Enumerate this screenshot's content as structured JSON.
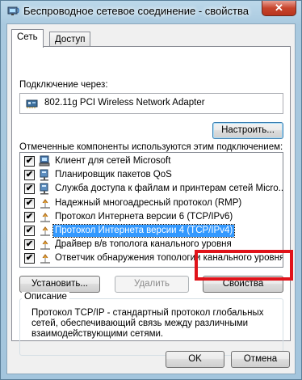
{
  "window": {
    "title": "Беспроводное сетевое соединение - свойства",
    "close_label": "✕"
  },
  "tabs": [
    {
      "label": "Сеть",
      "active": true
    },
    {
      "label": "Доступ",
      "active": false
    }
  ],
  "connection": {
    "label": "Подключение через:",
    "adapter": "802.11g PCI Wireless Network Adapter",
    "configure_button": "Настроить..."
  },
  "components": {
    "label": "Отмеченные компоненты используются этим подключением:",
    "items": [
      {
        "label": "Клиент для сетей Microsoft",
        "checked": true,
        "icon": "network-client-icon"
      },
      {
        "label": "Планировщик пакетов QoS",
        "checked": true,
        "icon": "network-service-icon"
      },
      {
        "label": "Служба доступа к файлам и принтерам сетей Micro...",
        "checked": true,
        "icon": "network-service-icon"
      },
      {
        "label": "Надежный многоадресный протокол (RMP)",
        "checked": true,
        "icon": "protocol-icon"
      },
      {
        "label": "Протокол Интернета версии 6 (TCP/IPv6)",
        "checked": true,
        "icon": "protocol-icon"
      },
      {
        "label": "Протокол Интернета версии 4 (TCP/IPv4)",
        "checked": true,
        "icon": "protocol-icon",
        "selected": true
      },
      {
        "label": "Драйвер в/в тополога канального уровня",
        "checked": true,
        "icon": "protocol-icon"
      },
      {
        "label": "Ответчик обнаружения топологии канального уровня",
        "checked": true,
        "icon": "protocol-icon"
      }
    ],
    "check_mark": "✔"
  },
  "buttons": {
    "install": "Установить...",
    "remove": "Удалить",
    "properties": "Свойства",
    "ok": "OK",
    "cancel": "Отмена"
  },
  "description": {
    "title": "Описание",
    "text": "Протокол TCP/IP - стандартный протокол глобальных сетей, обеспечивающий связь между различными взаимодействующими сетями."
  },
  "colors": {
    "selection": "#3399ff",
    "highlight_frame": "#e0131a"
  }
}
